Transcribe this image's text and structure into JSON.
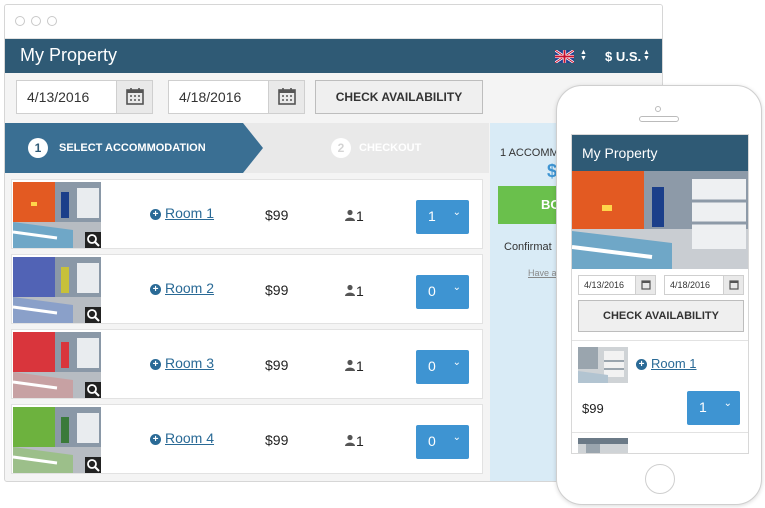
{
  "desktop": {
    "title": "My Property",
    "currency": "$ U.S.",
    "checkin": "4/13/2016",
    "checkout": "4/18/2016",
    "check_availability": "CHECK AVAILABILITY",
    "steps": [
      {
        "num": "1",
        "label": "SELECT ACCOMMODATION"
      },
      {
        "num": "2",
        "label": "CHECKOUT"
      }
    ],
    "rooms": [
      {
        "name": "Room 1",
        "price": "$99",
        "guests": "1",
        "qty": "1",
        "wall": "#e35a22",
        "bed": "#6fa7c7"
      },
      {
        "name": "Room 2",
        "price": "$99",
        "guests": "1",
        "qty": "0",
        "wall": "#5163b5",
        "bed": "#8aa0c9"
      },
      {
        "name": "Room 3",
        "price": "$99",
        "guests": "1",
        "qty": "0",
        "wall": "#d9353c",
        "bed": "#c7a1a3"
      },
      {
        "name": "Room 4",
        "price": "$99",
        "guests": "1",
        "qty": "0",
        "wall": "#6db23e",
        "bed": "#9cbf8a"
      }
    ],
    "side": {
      "summary": "1 ACCOMM",
      "amount": "$",
      "book": "BO",
      "confirm": "Confirmat",
      "have": "Have a"
    }
  },
  "mobile": {
    "title": "My Property",
    "checkin": "4/13/2016",
    "checkout": "4/18/2016",
    "check_availability": "CHECK AVAILABILITY",
    "room": {
      "name": "Room 1",
      "price": "$99",
      "qty": "1"
    }
  },
  "colors": {
    "header": "#2f5a75",
    "step_active": "#3a6f93",
    "accent": "#3e94d2",
    "book": "#6ac04c",
    "side": "#d9ebf6"
  }
}
